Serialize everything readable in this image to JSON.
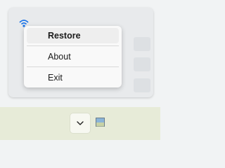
{
  "context_menu": {
    "items": [
      {
        "label": "Restore"
      },
      {
        "label": "About"
      },
      {
        "label": "Exit"
      }
    ]
  },
  "taskbar": {
    "overflow_button_icon": "chevron-down-icon",
    "tray_icon": "app-tray-icon"
  },
  "flyout": {
    "wifi_icon": "wifi-icon"
  },
  "colors": {
    "accent": "#1a73e8",
    "taskbar_bg": "#e7ebd8",
    "menu_bg": "#f9f9f9"
  }
}
